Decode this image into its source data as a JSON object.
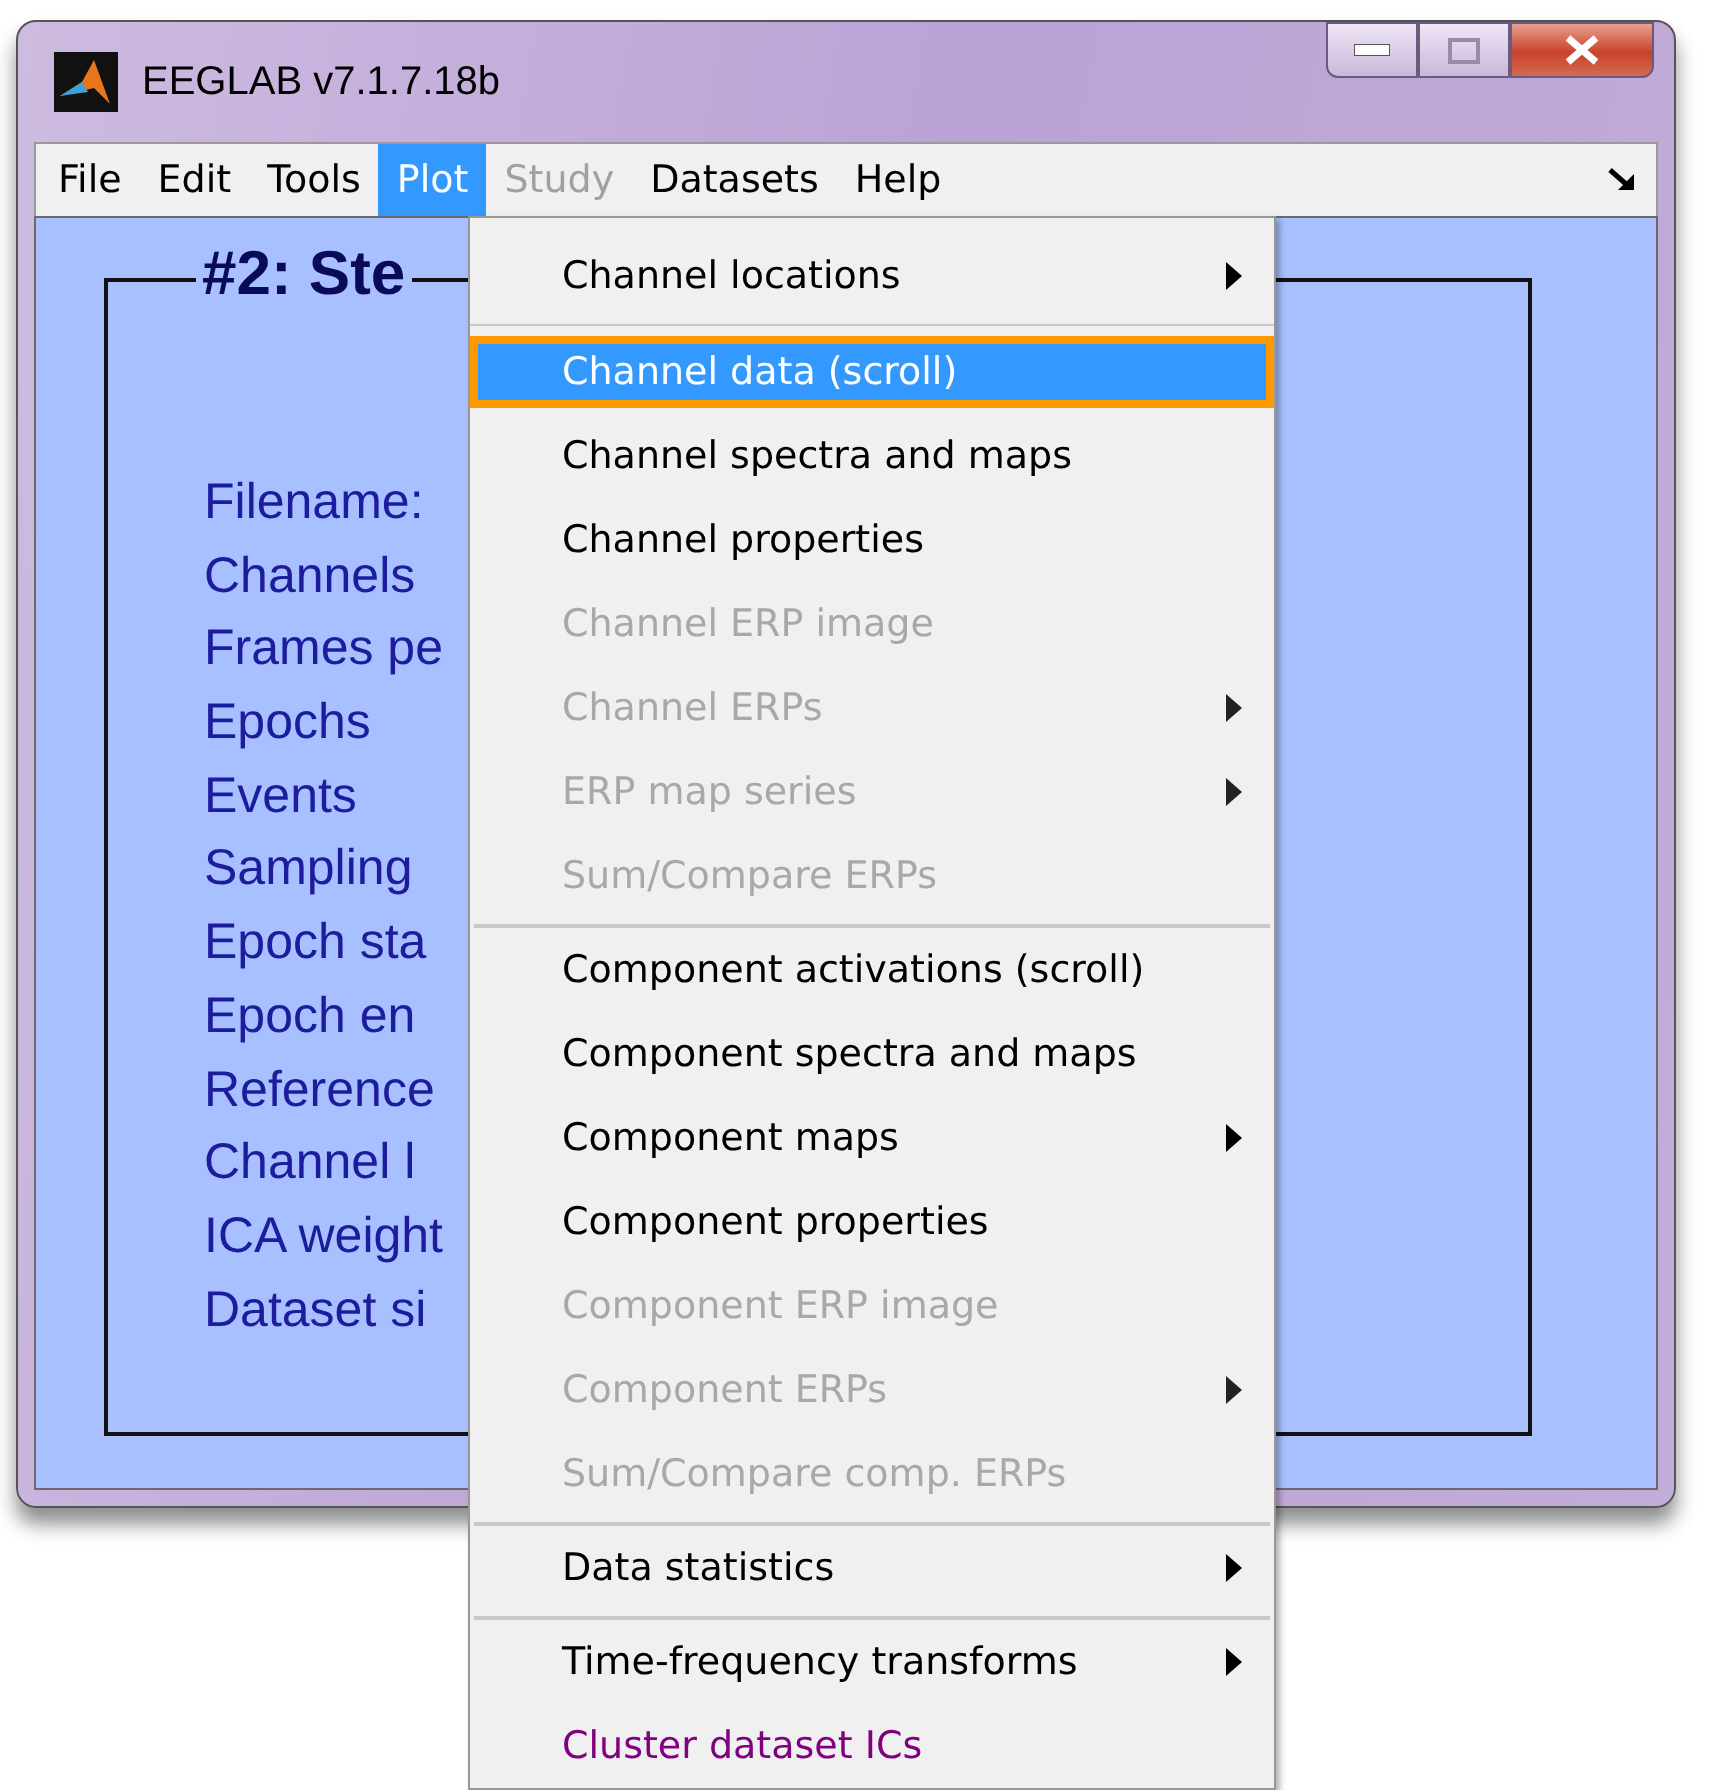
{
  "window": {
    "title": "EEGLAB v7.1.7.18b"
  },
  "menubar": [
    {
      "label": "File",
      "selected": false,
      "disabled": false
    },
    {
      "label": "Edit",
      "selected": false,
      "disabled": false
    },
    {
      "label": "Tools",
      "selected": false,
      "disabled": false
    },
    {
      "label": "Plot",
      "selected": true,
      "disabled": false
    },
    {
      "label": "Study",
      "selected": false,
      "disabled": true
    },
    {
      "label": "Datasets",
      "selected": false,
      "disabled": false
    },
    {
      "label": "Help",
      "selected": false,
      "disabled": false
    }
  ],
  "panel": {
    "title": "#2: Ste",
    "labels": [
      "Filename:",
      "Channels",
      "Frames pe",
      "Epochs",
      "Events",
      "Sampling",
      "Epoch sta",
      "Epoch en",
      "Reference",
      "Channel l",
      "ICA weight",
      "Dataset si"
    ]
  },
  "plot_menu": [
    {
      "label": "Channel locations",
      "disabled": false,
      "submenu": true,
      "selected": false,
      "separator_before": false
    },
    {
      "label": "Channel data (scroll)",
      "disabled": false,
      "submenu": false,
      "selected": true,
      "separator_before": true
    },
    {
      "label": "Channel spectra and maps",
      "disabled": false,
      "submenu": false,
      "selected": false,
      "separator_before": false
    },
    {
      "label": "Channel properties",
      "disabled": false,
      "submenu": false,
      "selected": false,
      "separator_before": false
    },
    {
      "label": "Channel ERP image",
      "disabled": true,
      "submenu": false,
      "selected": false,
      "separator_before": false
    },
    {
      "label": "Channel ERPs",
      "disabled": true,
      "submenu": true,
      "selected": false,
      "separator_before": false
    },
    {
      "label": "ERP map series",
      "disabled": true,
      "submenu": true,
      "selected": false,
      "separator_before": false
    },
    {
      "label": "Sum/Compare ERPs",
      "disabled": true,
      "submenu": false,
      "selected": false,
      "separator_before": false
    },
    {
      "label": "Component activations (scroll)",
      "disabled": false,
      "submenu": false,
      "selected": false,
      "separator_before": true
    },
    {
      "label": "Component spectra and maps",
      "disabled": false,
      "submenu": false,
      "selected": false,
      "separator_before": false
    },
    {
      "label": "Component maps",
      "disabled": false,
      "submenu": true,
      "selected": false,
      "separator_before": false
    },
    {
      "label": "Component properties",
      "disabled": false,
      "submenu": false,
      "selected": false,
      "separator_before": false
    },
    {
      "label": "Component ERP image",
      "disabled": true,
      "submenu": false,
      "selected": false,
      "separator_before": false
    },
    {
      "label": "Component ERPs",
      "disabled": true,
      "submenu": true,
      "selected": false,
      "separator_before": false
    },
    {
      "label": "Sum/Compare comp. ERPs",
      "disabled": true,
      "submenu": false,
      "selected": false,
      "separator_before": false
    },
    {
      "label": "Data statistics",
      "disabled": false,
      "submenu": true,
      "selected": false,
      "separator_before": true
    },
    {
      "label": "Time-frequency transforms",
      "disabled": false,
      "submenu": true,
      "selected": false,
      "separator_before": true
    },
    {
      "label": "Cluster dataset ICs",
      "disabled": false,
      "submenu": false,
      "selected": false,
      "separator_before": false,
      "color": "#800080"
    }
  ]
}
